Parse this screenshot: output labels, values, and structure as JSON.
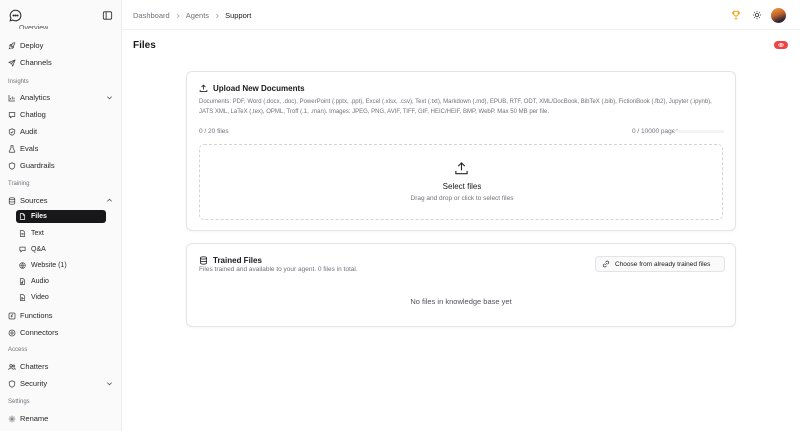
{
  "sidebar": {
    "clipped_top_label": "Overview",
    "items_top": [
      {
        "label": "Deploy",
        "icon": "rocket-icon"
      },
      {
        "label": "Channels",
        "icon": "send-icon"
      }
    ],
    "sections": {
      "insights": "Insights",
      "training": "Training",
      "access": "Access",
      "settings": "Settings"
    },
    "insights_items": [
      {
        "label": "Analytics",
        "icon": "chart-icon"
      },
      {
        "label": "Chatlog",
        "icon": "chat-icon"
      },
      {
        "label": "Audit",
        "icon": "shield-check-icon"
      },
      {
        "label": "Evals",
        "icon": "beaker-icon"
      },
      {
        "label": "Guardrails",
        "icon": "shield-icon"
      }
    ],
    "sources_label": "Sources",
    "sources_sub": [
      {
        "label": "Files",
        "icon": "file-icon"
      },
      {
        "label": "Text",
        "icon": "text-icon"
      },
      {
        "label": "Q&A",
        "icon": "qa-icon"
      },
      {
        "label": "Website (1)",
        "icon": "globe-icon"
      },
      {
        "label": "Audio",
        "icon": "audio-icon"
      },
      {
        "label": "Video",
        "icon": "video-icon"
      }
    ],
    "functions_label": "Functions",
    "connectors_label": "Connectors",
    "chatters_label": "Chatters",
    "security_label": "Security",
    "rename_label": "Rename"
  },
  "header": {
    "breadcrumb": [
      "Dashboard",
      "Agents",
      "Support"
    ]
  },
  "page": {
    "title": "Files"
  },
  "upload": {
    "title": "Upload New Documents",
    "docs": "Documents: PDF, Word (.docx, .doc), PowerPoint (.pptx, .ppt), Excel (.xlsx, .csv), Text (.txt), Markdown (.md), EPUB, RTF, ODT, XML/DocBook, BibTeX (.bib), FictionBook (.fb2), Jupyter (.ipynb), JATS XML, LaTeX (.tex), OPML, Troff (.1, .man). Images: JPEG, PNG, AVIF, TIFF, GIF, HEIC/HEIF, BMP, WebP. Max 50 MB per file.",
    "files_count": "0 / 20 files",
    "pages_count": "0 / 10000 pages",
    "pages_progress_percent": 0,
    "dropzone_title": "Select files",
    "dropzone_sub": "Drag and drop or click to select files"
  },
  "trained": {
    "title": "Trained Files",
    "subtitle": "Files trained and available to your agent. 0 files in total.",
    "choose_button": "Choose from already trained files",
    "empty": "No files in knowledge base yet"
  },
  "colors": {
    "accent": "#18181b",
    "badge": "#ef4444",
    "trophy": "#f59e0b"
  }
}
